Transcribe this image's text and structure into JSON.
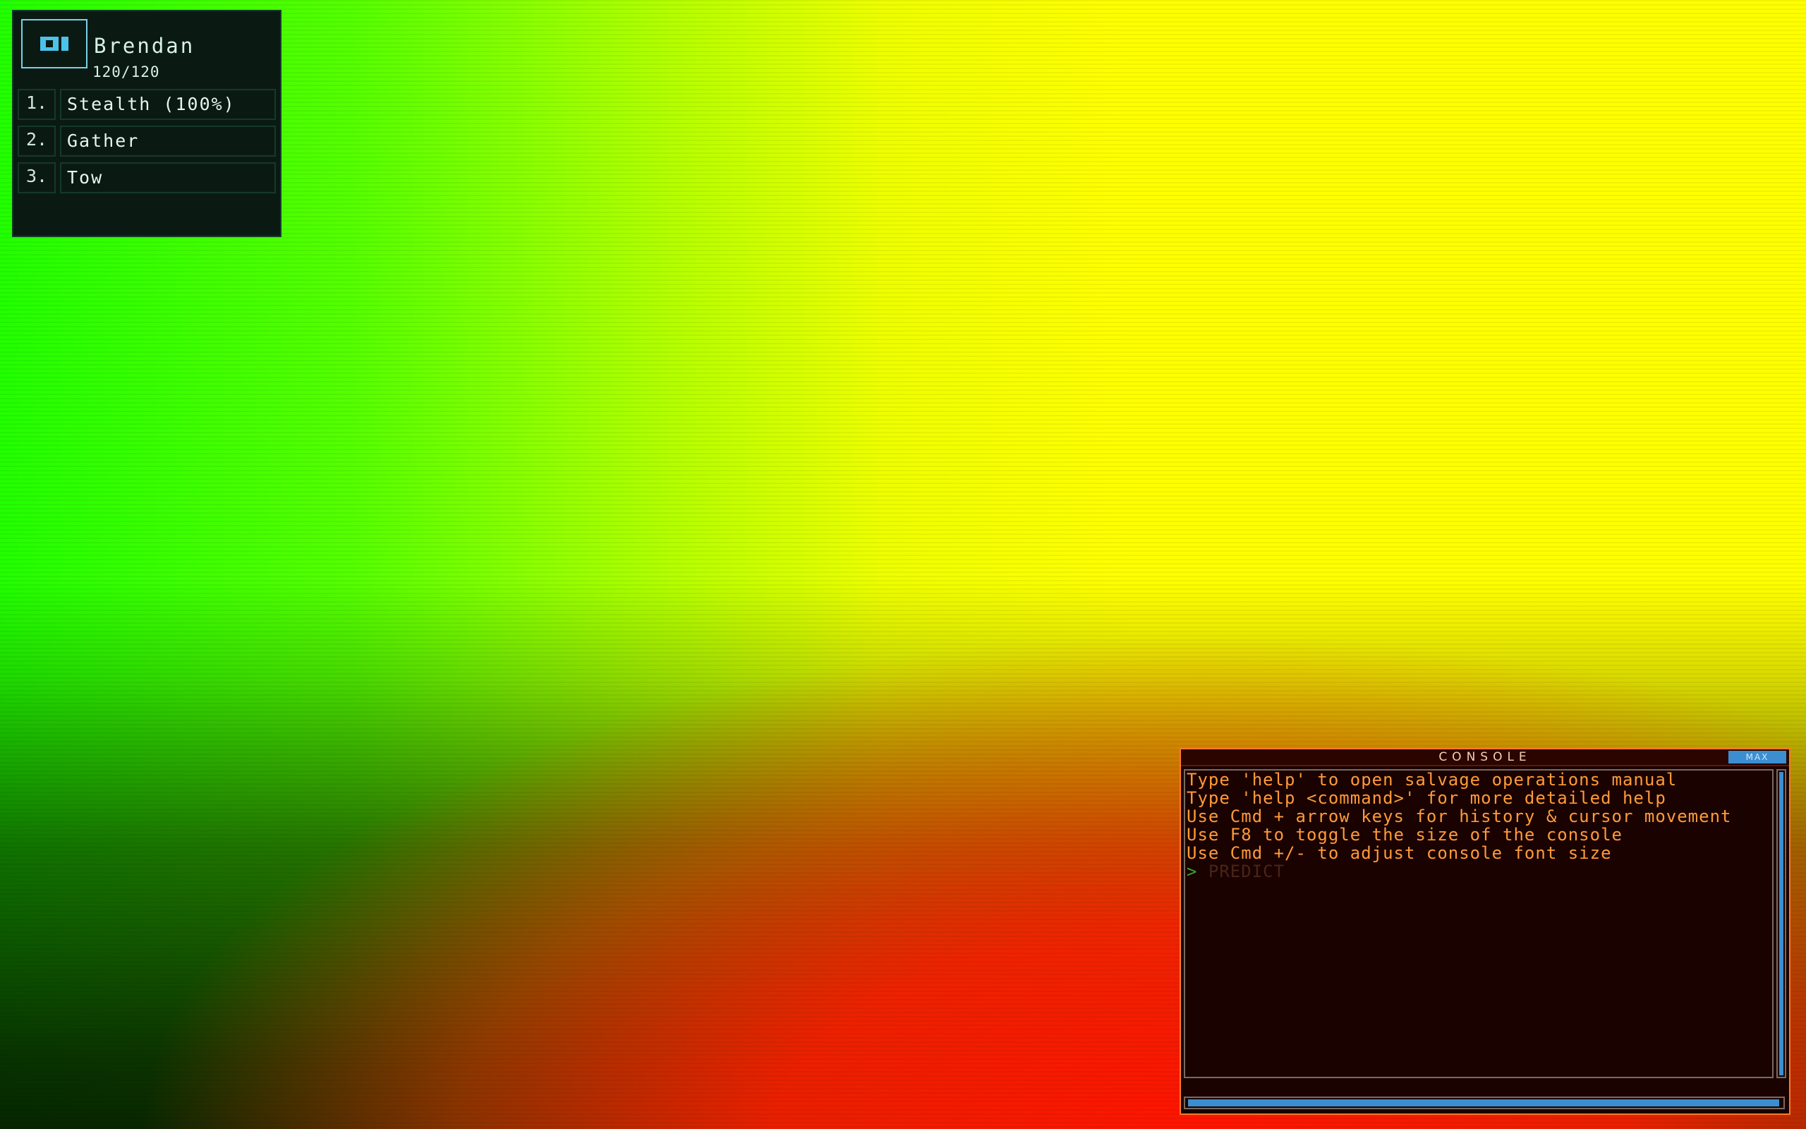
{
  "drone": {
    "id_icon": "drone-id-icon",
    "name": "Brendan",
    "hp": "120/120",
    "commands": [
      {
        "num": "1.",
        "label": "Stealth (100%)"
      },
      {
        "num": "2.",
        "label": "Gather"
      },
      {
        "num": "3.",
        "label": "Tow"
      }
    ]
  },
  "console": {
    "title": "CONSOLE",
    "max_label": "MAX",
    "lines": [
      "Type 'help' to open salvage operations manual",
      "Type 'help <command>' for more detailed help",
      "Use Cmd + arrow keys for history & cursor movement",
      "Use F8 to toggle the size of the console",
      "Use Cmd +/- to adjust console font size"
    ],
    "prompt_caret": ">",
    "prompt_text": "PREDICT"
  },
  "colors": {
    "console_text": "#ff9a3a",
    "console_border": "#ff7a28",
    "accent_blue": "#3b8fd0",
    "panel_bg": "#0a1a12"
  }
}
